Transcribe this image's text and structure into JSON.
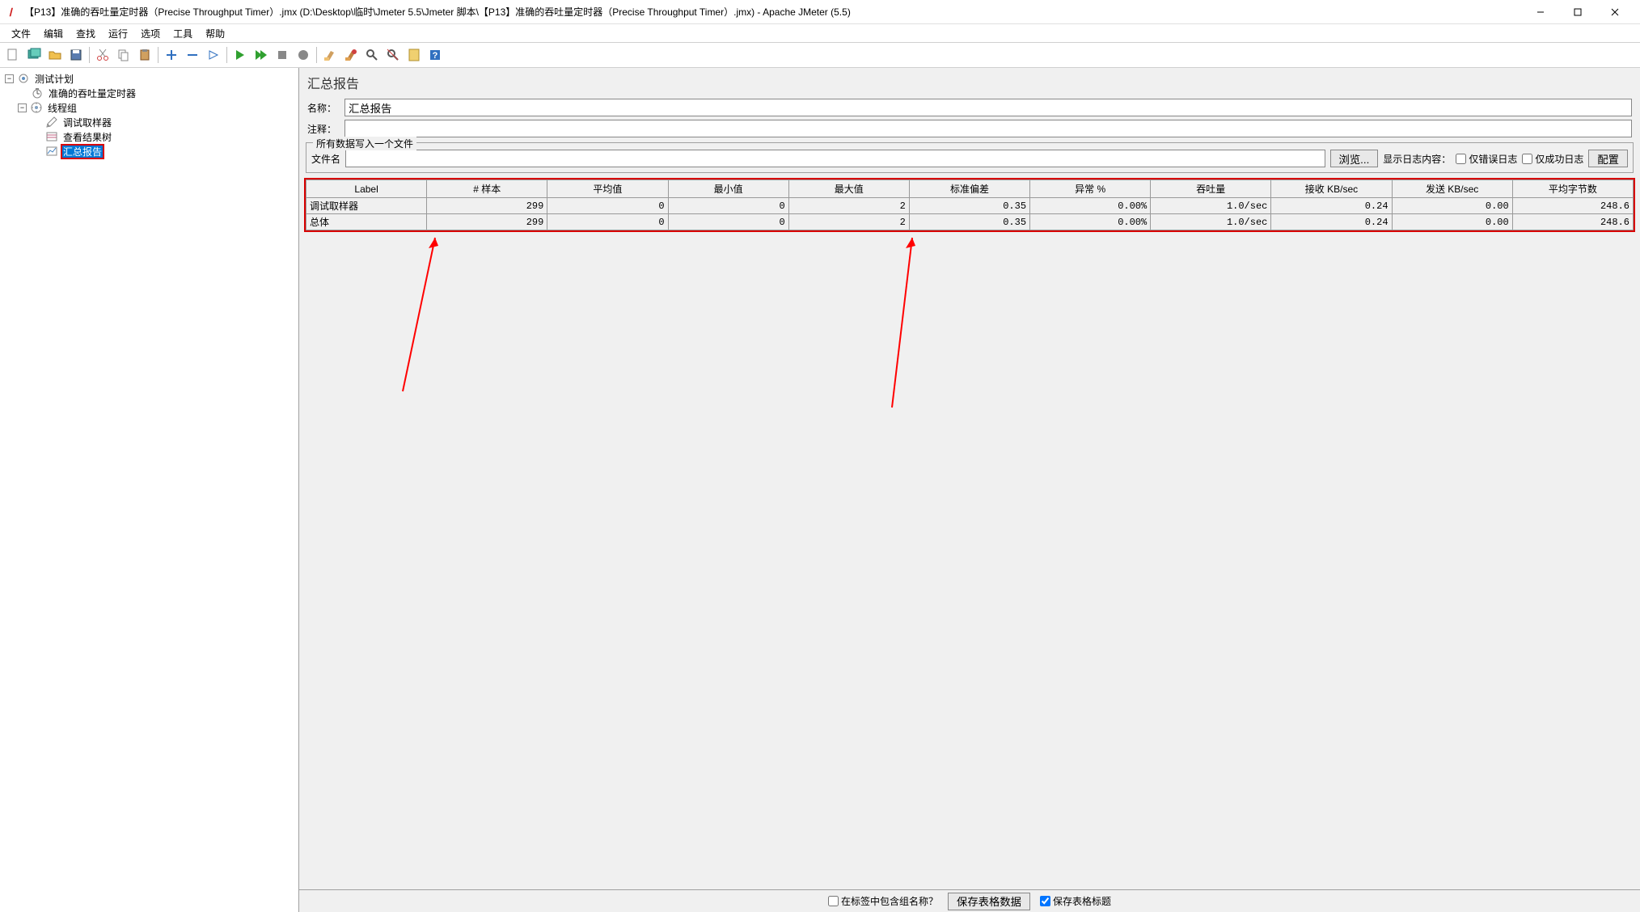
{
  "window": {
    "title": "【P13】准确的吞吐量定时器（Precise Throughput Timer）.jmx (D:\\Desktop\\临时\\Jmeter 5.5\\Jmeter 脚本\\【P13】准确的吞吐量定时器（Precise Throughput Timer）.jmx) - Apache JMeter (5.5)"
  },
  "menu": {
    "file": "文件",
    "edit": "编辑",
    "search": "查找",
    "run": "运行",
    "options": "选项",
    "tools": "工具",
    "help": "帮助"
  },
  "tree": {
    "root": "测试计划",
    "n1": "准确的吞吐量定时器",
    "n2": "线程组",
    "n2a": "调试取样器",
    "n2b": "查看结果树",
    "n2c": "汇总报告"
  },
  "panel": {
    "title": "汇总报告",
    "name_label": "名称：",
    "name_value": "汇总报告",
    "comment_label": "注释：",
    "comment_value": "",
    "fieldset_legend": "所有数据写入一个文件",
    "filename_label": "文件名",
    "filename_value": "",
    "browse": "浏览...",
    "log_display": "显示日志内容：",
    "errors_only": "仅错误日志",
    "success_only": "仅成功日志",
    "configure": "配置"
  },
  "table": {
    "headers": [
      "Label",
      "# 样本",
      "平均值",
      "最小值",
      "最大值",
      "标准偏差",
      "异常 %",
      "吞吐量",
      "接收 KB/sec",
      "发送 KB/sec",
      "平均字节数"
    ],
    "rows": [
      {
        "label": "调试取样器",
        "samples": "299",
        "avg": "0",
        "min": "0",
        "max": "2",
        "stddev": "0.35",
        "error": "0.00%",
        "throughput": "1.0/sec",
        "recv": "0.24",
        "sent": "0.00",
        "bytes": "248.6"
      },
      {
        "label": "总体",
        "samples": "299",
        "avg": "0",
        "min": "0",
        "max": "2",
        "stddev": "0.35",
        "error": "0.00%",
        "throughput": "1.0/sec",
        "recv": "0.24",
        "sent": "0.00",
        "bytes": "248.6"
      }
    ]
  },
  "bottom": {
    "include_group": "在标签中包含组名称？",
    "save_table": "保存表格数据",
    "save_header": "保存表格标题"
  }
}
